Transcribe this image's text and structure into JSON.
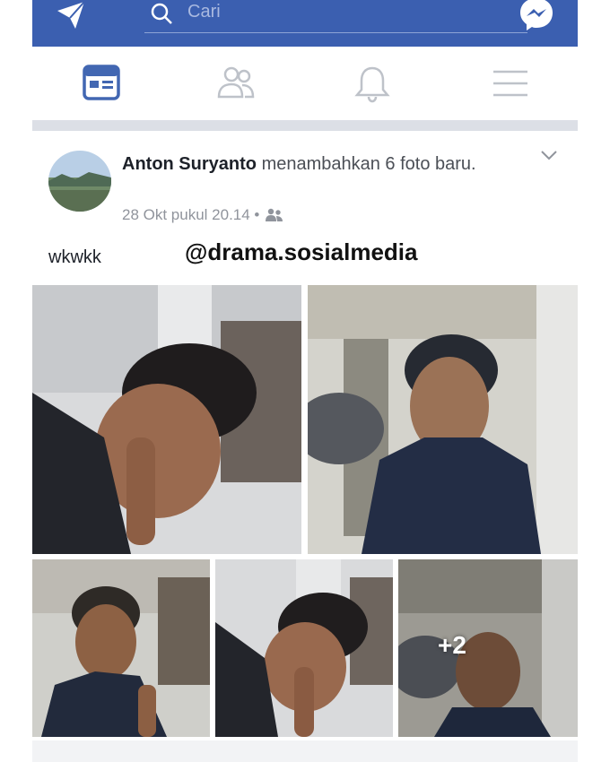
{
  "search": {
    "placeholder": "Cari"
  },
  "post": {
    "author": "Anton Suryanto",
    "action_text": "menambahkan 6 foto baru.",
    "timestamp": "28 Okt pukul 20.14 •",
    "audience_icon": "friends-icon",
    "caption": "wkwkk",
    "more_photos": "+2"
  },
  "watermark": "@drama.sosialmedia",
  "colors": {
    "brand": "#3b5fb0",
    "tab_active": "#4267b2",
    "tab_inactive": "#bec2c9"
  },
  "icons": {
    "top_left": "paper-plane-icon",
    "search": "search-icon",
    "top_right": "messenger-icon",
    "tabs": [
      "news-feed-icon",
      "friends-icon",
      "notifications-bell-icon",
      "menu-icon"
    ]
  }
}
